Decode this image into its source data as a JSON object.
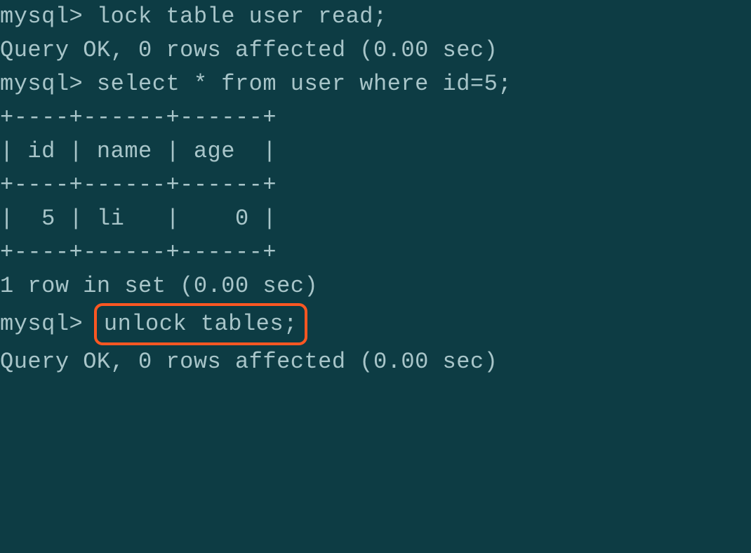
{
  "terminal": {
    "prompt": "mysql>",
    "lines": {
      "cmd1_prompt": "mysql> ",
      "cmd1": "lock table user read;",
      "result1": "Query OK, 0 rows affected (0.00 sec)",
      "blank": "",
      "cmd2_prompt": "mysql> ",
      "cmd2": "select * from user where id=5;",
      "tbl_top": "+----+------+------+",
      "tbl_header": "| id | name | age  |",
      "tbl_mid": "+----+------+------+",
      "tbl_row": "|  5 | li   |    0 |",
      "tbl_bot": "+----+------+------+",
      "result2": "1 row in set (0.00 sec)",
      "cmd3_prompt": "mysql> ",
      "cmd3_highlighted": "unlock tables;",
      "result3": "Query OK, 0 rows affected (0.00 sec)"
    }
  }
}
